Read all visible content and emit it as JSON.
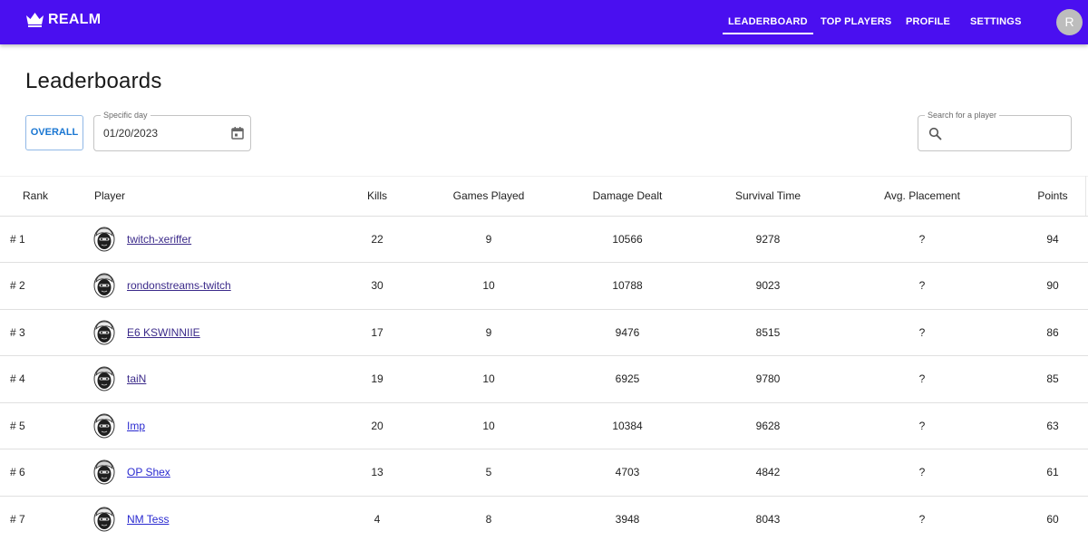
{
  "brand": {
    "name": "REALM",
    "icon": "crown-icon"
  },
  "nav": {
    "items": [
      {
        "label": "LEADERBOARD",
        "active": true
      },
      {
        "label": "TOP PLAYERS",
        "active": false
      },
      {
        "label": "PROFILE",
        "active": false
      },
      {
        "label": "SETTINGS",
        "active": false
      }
    ],
    "avatar_letter": "R"
  },
  "page": {
    "title": "Leaderboards"
  },
  "filters": {
    "overall_label": "OVERALL",
    "date_label": "Specific day",
    "date_value": "01/20/2023",
    "search_label": "Search for a player",
    "search_value": ""
  },
  "table": {
    "columns": [
      "Rank",
      "Player",
      "Kills",
      "Games Played",
      "Damage Dealt",
      "Survival Time",
      "Avg. Placement",
      "Points"
    ],
    "rows": [
      {
        "rank": "# 1",
        "player": "twitch-xeriffer",
        "kills": "22",
        "games": "9",
        "damage": "10566",
        "survival": "9278",
        "avg": "?",
        "points": "94"
      },
      {
        "rank": "# 2",
        "player": "rondonstreams-twitch",
        "kills": "30",
        "games": "10",
        "damage": "10788",
        "survival": "9023",
        "avg": "?",
        "points": "90"
      },
      {
        "rank": "# 3",
        "player": "E6 KSWINNIIE",
        "kills": "17",
        "games": "9",
        "damage": "9476",
        "survival": "8515",
        "avg": "?",
        "points": "86"
      },
      {
        "rank": "# 4",
        "player": "taiN",
        "kills": "19",
        "games": "10",
        "damage": "6925",
        "survival": "9780",
        "avg": "?",
        "points": "85"
      },
      {
        "rank": "# 5",
        "player": "Imp",
        "kills": "20",
        "games": "10",
        "damage": "10384",
        "survival": "9628",
        "avg": "?",
        "points": "63"
      },
      {
        "rank": "# 6",
        "player": "OP Shex",
        "kills": "13",
        "games": "5",
        "damage": "4703",
        "survival": "4842",
        "avg": "?",
        "points": "61"
      },
      {
        "rank": "# 7",
        "player": "NM Tess",
        "kills": "4",
        "games": "8",
        "damage": "3948",
        "survival": "8043",
        "avg": "?",
        "points": "60"
      }
    ]
  },
  "colors": {
    "topbar": "#4a0ff0",
    "accent": "#1976d2",
    "link": "#3b2a8a"
  }
}
